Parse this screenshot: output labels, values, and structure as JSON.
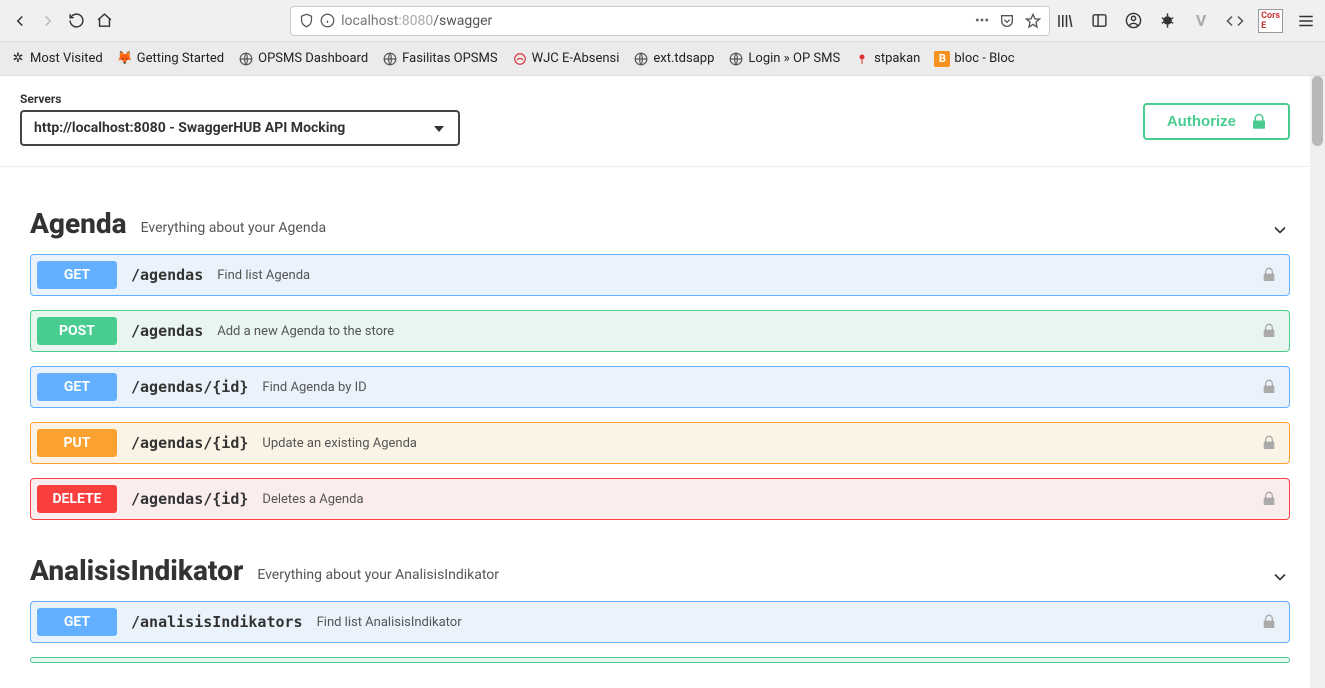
{
  "browser": {
    "url_host": "localhost",
    "url_port": ":8080",
    "url_path": "/swagger"
  },
  "bookmarks": [
    {
      "label": "Most Visited"
    },
    {
      "label": "Getting Started"
    },
    {
      "label": "OPSMS Dashboard"
    },
    {
      "label": "Fasilitas OPSMS"
    },
    {
      "label": "WJC E-Absensi"
    },
    {
      "label": "ext.tdsapp"
    },
    {
      "label": "Login » OP SMS"
    },
    {
      "label": "stpakan"
    },
    {
      "label": "bloc - Bloc"
    }
  ],
  "servers": {
    "label": "Servers",
    "selected": "http://localhost:8080 - SwaggerHUB API Mocking"
  },
  "authorize_label": "Authorize",
  "tags": [
    {
      "name": "Agenda",
      "desc": "Everything about your Agenda",
      "ops": [
        {
          "method": "GET",
          "path": "/agendas",
          "summary": "Find list Agenda"
        },
        {
          "method": "POST",
          "path": "/agendas",
          "summary": "Add a new Agenda to the store"
        },
        {
          "method": "GET",
          "path": "/agendas/{id}",
          "summary": "Find Agenda by ID"
        },
        {
          "method": "PUT",
          "path": "/agendas/{id}",
          "summary": "Update an existing Agenda"
        },
        {
          "method": "DELETE",
          "path": "/agendas/{id}",
          "summary": "Deletes a Agenda"
        }
      ]
    },
    {
      "name": "AnalisisIndikator",
      "desc": "Everything about your AnalisisIndikator",
      "ops": [
        {
          "method": "GET",
          "path": "/analisisIndikators",
          "summary": "Find list AnalisisIndikator"
        }
      ]
    }
  ]
}
